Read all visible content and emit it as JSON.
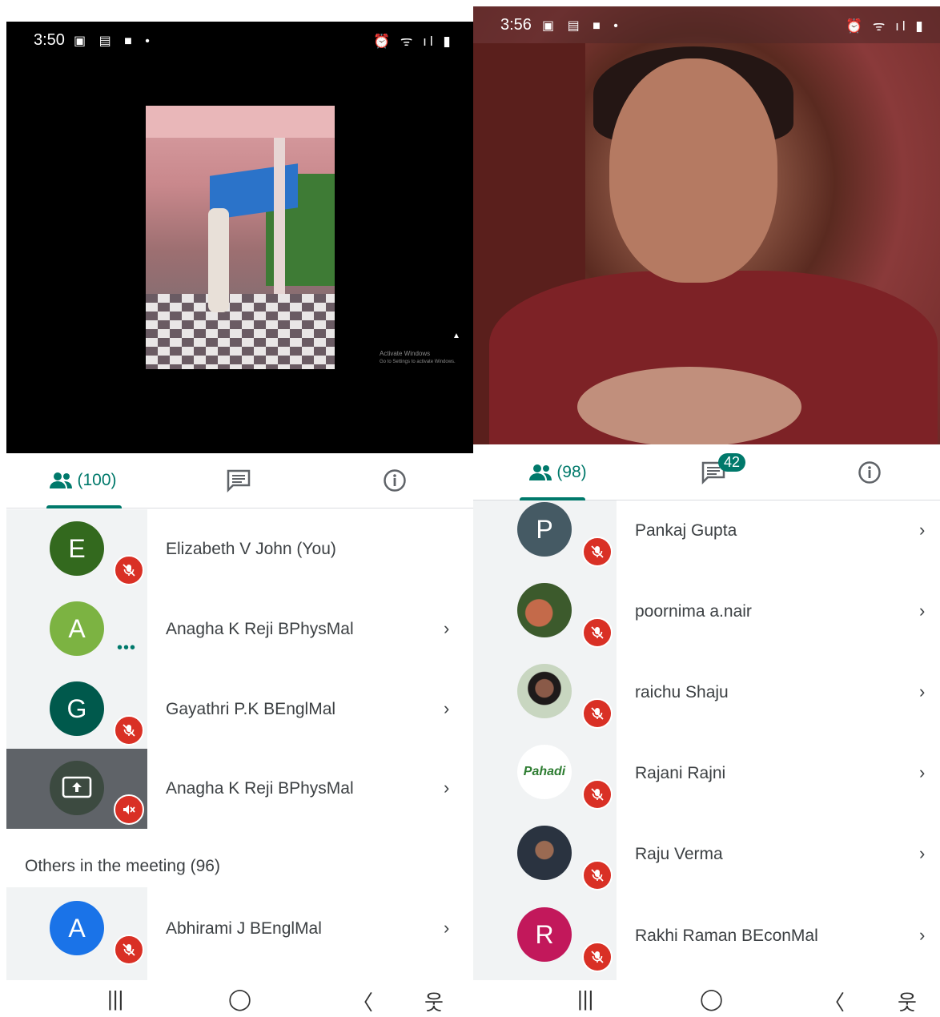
{
  "left": {
    "status": {
      "time": "3:50",
      "left_icons": "▣ ▤ ■ •",
      "right_icons": "⏰ ᯤ ıl ▮"
    },
    "watermark": {
      "line1": "Activate Windows",
      "line2": "Go to Settings to activate Windows."
    },
    "tabs": {
      "people_count": "(100)"
    },
    "participants": [
      {
        "initial": "E",
        "name": "Elizabeth V John (You)",
        "color": "#33691e"
      },
      {
        "initial": "A",
        "name": "Anagha K Reji BPhysMal",
        "color": "#7cb342"
      },
      {
        "initial": "G",
        "name": "Gayathri P.K BEnglMal",
        "color": "#00594c"
      },
      {
        "initial": "",
        "name": "Anagha K Reji BPhysMal",
        "color": "#3c4a40"
      }
    ],
    "others_label": "Others in the meeting (96)",
    "others": [
      {
        "initial": "A",
        "name": "Abhirami J BEnglMal",
        "color": "#1a73e8"
      }
    ]
  },
  "right": {
    "status": {
      "time": "3:56",
      "left_icons": "▣ ▤ ■ •",
      "right_icons": "⏰ ᯤ ıl ▮"
    },
    "tabs": {
      "people_count": "(98)",
      "chat_badge": "42"
    },
    "participants": [
      {
        "initial": "P",
        "name": "Pankaj Gupta",
        "color": "#455a64"
      },
      {
        "initial": "",
        "name": "poornima a.nair",
        "color": "#3c5a2c"
      },
      {
        "initial": "",
        "name": "raichu Shaju",
        "color": "#c8d6c0"
      },
      {
        "initial": "",
        "name": "Rajani Rajni",
        "color": "#ffffff",
        "logo_text": "Pahadi"
      },
      {
        "initial": "",
        "name": "Raju Verma",
        "color": "#2a3340"
      },
      {
        "initial": "R",
        "name": "Rakhi Raman BEconMal",
        "color": "#c2185b"
      }
    ]
  },
  "nav": {
    "recents": "|||",
    "home": "◯",
    "back": "〈",
    "accessibility": "웃"
  }
}
